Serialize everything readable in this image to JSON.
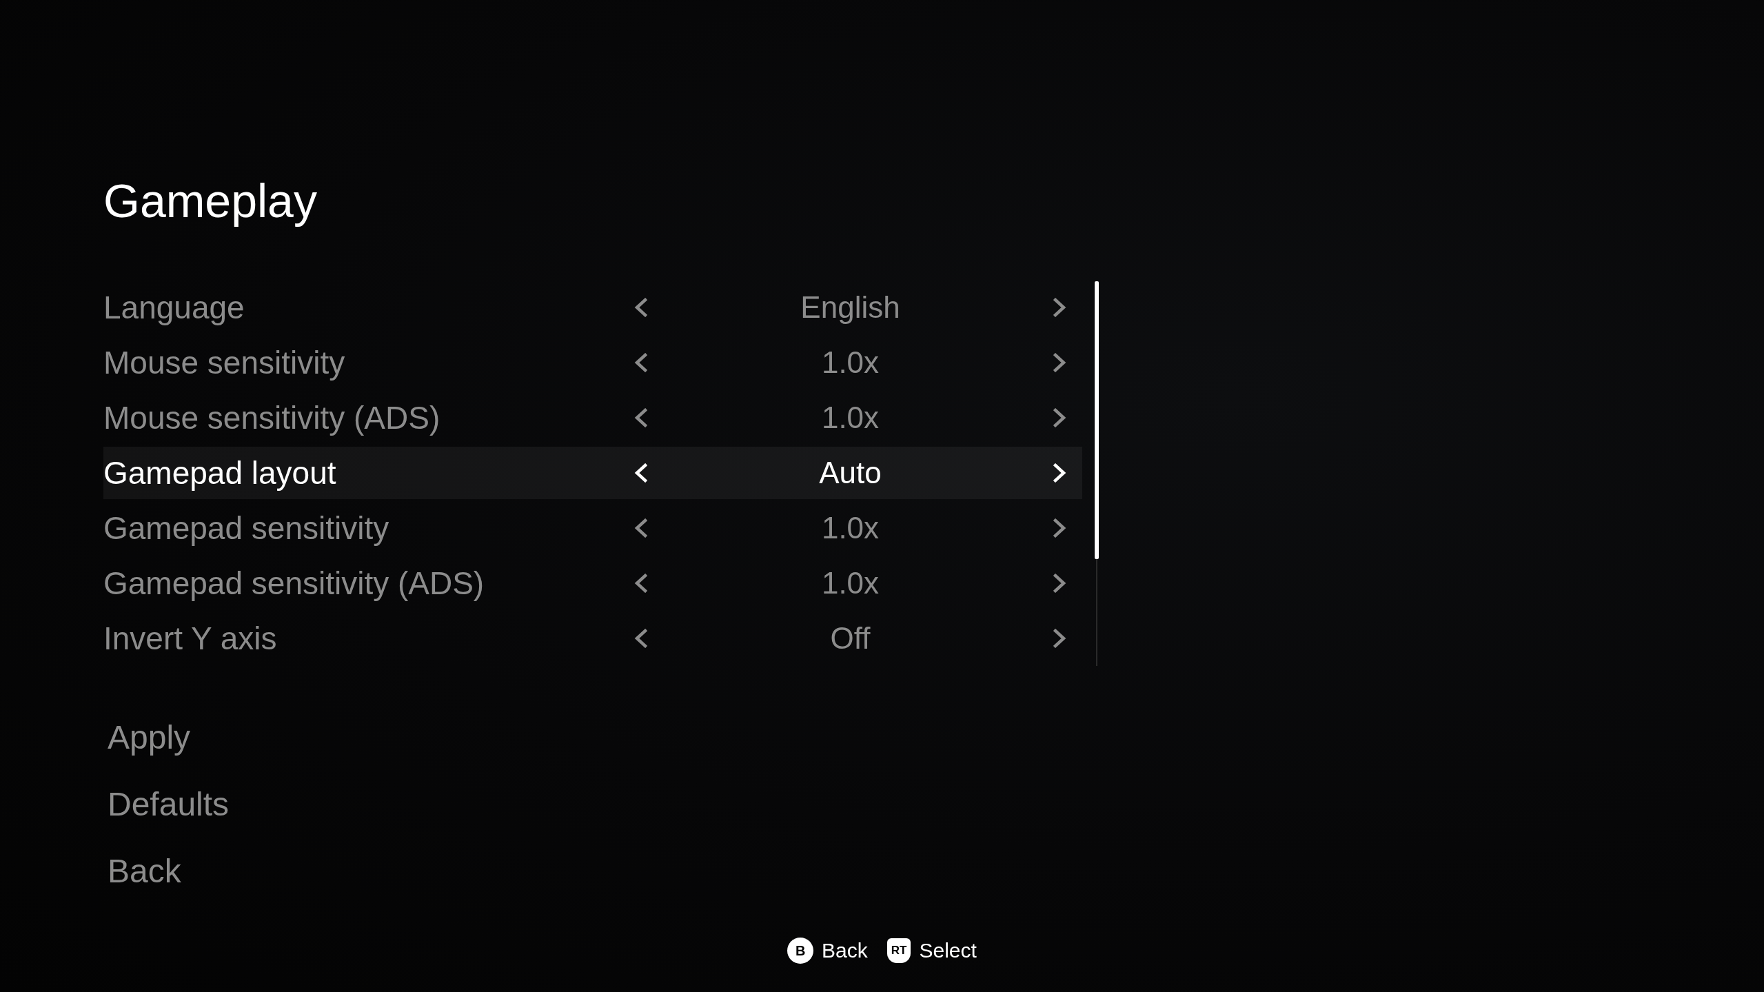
{
  "title": "Gameplay",
  "settings": [
    {
      "label": "Language",
      "value": "English",
      "selected": false
    },
    {
      "label": "Mouse sensitivity",
      "value": "1.0x",
      "selected": false
    },
    {
      "label": "Mouse sensitivity (ADS)",
      "value": "1.0x",
      "selected": false
    },
    {
      "label": "Gamepad layout",
      "value": "Auto",
      "selected": true
    },
    {
      "label": "Gamepad sensitivity",
      "value": "1.0x",
      "selected": false
    },
    {
      "label": "Gamepad sensitivity (ADS)",
      "value": "1.0x",
      "selected": false
    },
    {
      "label": "Invert Y axis",
      "value": "Off",
      "selected": false
    }
  ],
  "actions": [
    "Apply",
    "Defaults",
    "Back"
  ],
  "hints": [
    {
      "kind": "circle",
      "key": "B",
      "label": "Back"
    },
    {
      "kind": "trigger",
      "key": "RT",
      "label": "Select"
    }
  ]
}
